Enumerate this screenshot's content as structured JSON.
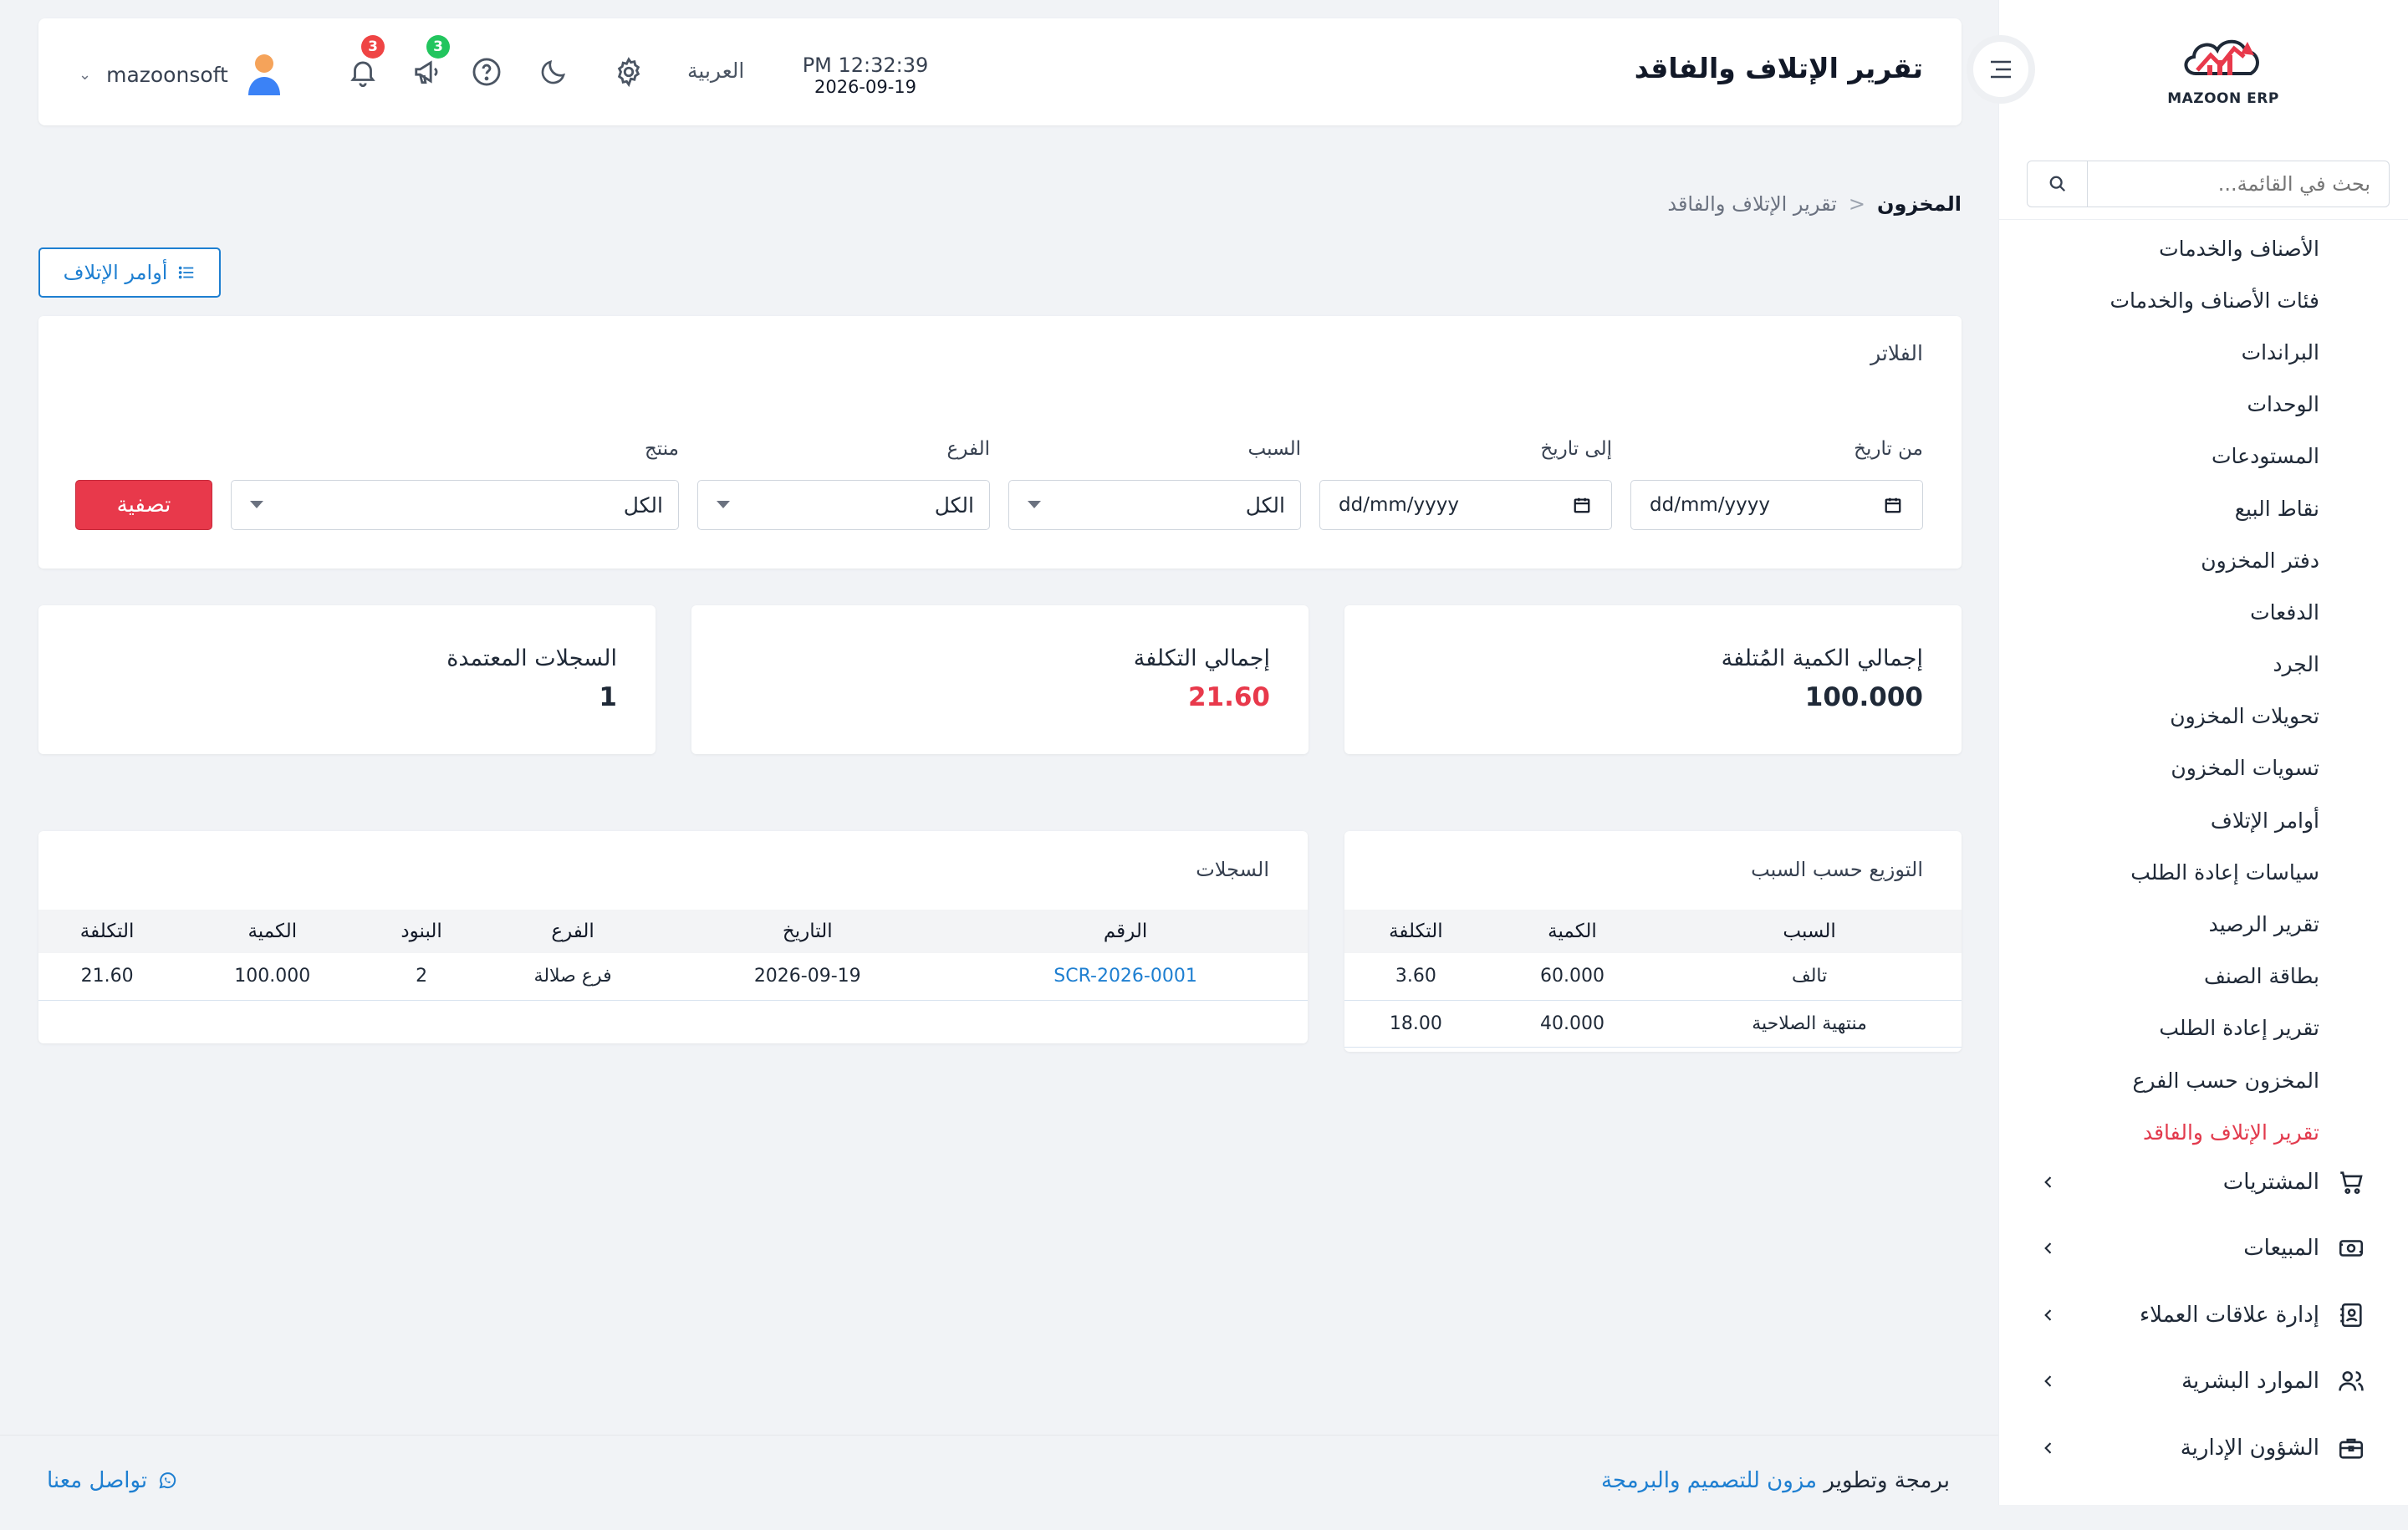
{
  "header": {
    "title": "تقرير الإتلاف والفاقد",
    "time": "PM 12:32:39",
    "date": "2026-09-19",
    "language": "العربية",
    "username": "mazoonsoft",
    "notifications_count": "3",
    "announcements_count": "3"
  },
  "brand": {
    "logo_text": "MAZOON ERP",
    "accent": "#e8394b",
    "link_color": "#1e7fd1"
  },
  "sidebar": {
    "search_placeholder": "بحث في القائمة...",
    "sub_items": [
      {
        "label": "الأصناف والخدمات"
      },
      {
        "label": "فئات الأصناف والخدمات"
      },
      {
        "label": "البراندات"
      },
      {
        "label": "الوحدات"
      },
      {
        "label": "المستودعات"
      },
      {
        "label": "نقاط البيع"
      },
      {
        "label": "دفتر المخزون"
      },
      {
        "label": "الدفعات"
      },
      {
        "label": "الجرد"
      },
      {
        "label": "تحويلات المخزون"
      },
      {
        "label": "تسويات المخزون"
      },
      {
        "label": "أوامر الإتلاف"
      },
      {
        "label": "سياسات إعادة الطلب"
      },
      {
        "label": "تقرير الرصيد"
      },
      {
        "label": "بطاقة الصنف"
      },
      {
        "label": "تقرير إعادة الطلب"
      },
      {
        "label": "المخزون حسب الفرع"
      },
      {
        "label": "تقرير الإتلاف والفاقد"
      }
    ],
    "main_items": [
      {
        "label": "المشتريات",
        "icon": "cart-icon"
      },
      {
        "label": "المبيعات",
        "icon": "cash-icon"
      },
      {
        "label": "إدارة علاقات العملاء",
        "icon": "contacts-icon"
      },
      {
        "label": "الموارد البشرية",
        "icon": "users-icon"
      },
      {
        "label": "الشؤون الإدارية",
        "icon": "briefcase-icon"
      }
    ]
  },
  "breadcrumb": {
    "root": "المخزون",
    "separator": "<",
    "current": "تقرير الإتلاف والفاقد"
  },
  "actions": {
    "orders_button": "أوامر الإتلاف"
  },
  "filters": {
    "title": "الفلاتر",
    "from_date_label": "من تاريخ",
    "from_date_value": "dd/mm/yyyy",
    "to_date_label": "إلى تاريخ",
    "to_date_value": "dd/mm/yyyy",
    "reason_label": "السبب",
    "reason_value": "الكل",
    "branch_label": "الفرع",
    "branch_value": "الكل",
    "product_label": "منتج",
    "product_value": "الكل",
    "apply_button": "تصفية"
  },
  "stats": {
    "total_qty_label": "إجمالي الكمية المُتلفة",
    "total_qty_value": "100.000",
    "total_cost_label": "إجمالي التكلفة",
    "total_cost_value": "21.60",
    "approved_label": "السجلات المعتمدة",
    "approved_value": "1"
  },
  "by_reason": {
    "title": "التوزيع حسب السبب",
    "headers": [
      "السبب",
      "الكمية",
      "التكلفة"
    ],
    "rows": [
      [
        "تالف",
        "60.000",
        "3.60"
      ],
      [
        "منتهية الصلاحية",
        "40.000",
        "18.00"
      ]
    ]
  },
  "records": {
    "title": "السجلات",
    "headers": [
      "الرقم",
      "التاريخ",
      "الفرع",
      "البنود",
      "الكمية",
      "التكلفة"
    ],
    "rows": [
      [
        "SCR-2026-0001",
        "2026-09-19",
        "فرع صلالة",
        "2",
        "100.000",
        "21.60"
      ]
    ]
  },
  "footer": {
    "credit_prefix": "برمجة وتطوير",
    "credit_link": "مزون للتصميم والبرمجة",
    "contact": "تواصل معنا"
  }
}
